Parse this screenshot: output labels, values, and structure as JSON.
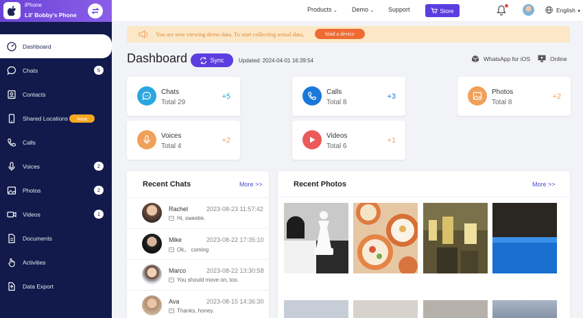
{
  "device": {
    "type": "iPhone",
    "name": "Lil' Bobby's Phone"
  },
  "sidebar": {
    "items": [
      {
        "label": "Dashboard",
        "icon": "dashboard-icon",
        "active": true
      },
      {
        "label": "Chats",
        "icon": "chat-icon",
        "badge": "5"
      },
      {
        "label": "Contacts",
        "icon": "contacts-icon"
      },
      {
        "label": "Shared Locations",
        "icon": "phone-location-icon",
        "new": "New"
      },
      {
        "label": "Calls",
        "icon": "phone-icon"
      },
      {
        "label": "Voices",
        "icon": "microphone-icon",
        "badge": "2"
      },
      {
        "label": "Photos",
        "icon": "image-icon",
        "badge": "2"
      },
      {
        "label": "Videos",
        "icon": "video-icon",
        "badge": "1"
      },
      {
        "label": "Documents",
        "icon": "document-icon"
      },
      {
        "label": "Activities",
        "icon": "hand-pointer-icon"
      },
      {
        "label": "Data Export",
        "icon": "export-icon"
      }
    ]
  },
  "topbar": {
    "products": "Products",
    "demo": "Demo",
    "support": "Support",
    "store": "Store",
    "language": "English"
  },
  "notice": {
    "text": "You are now viewing demo data. To start collecting actual data,",
    "button": "bind a device"
  },
  "header": {
    "title": "Dashboard",
    "sync": "Sync",
    "updated": "Updated: 2024-04-01 16:39:54",
    "whatsapp": "WhatsApp for iOS",
    "status": "Online"
  },
  "stats": [
    {
      "name": "Chats",
      "total": "Total   29",
      "inc": "+5",
      "color": "#2aa6e0"
    },
    {
      "name": "Calls",
      "total": "Total   8",
      "inc": "+3",
      "color": "#1a78d8"
    },
    {
      "name": "Photos",
      "total": "Total   8",
      "inc": "+2",
      "color": "#f0a05a"
    },
    {
      "name": "Voices",
      "total": "Total   4",
      "inc": "+2",
      "color": "#f0a05a"
    },
    {
      "name": "Videos",
      "total": "Total   6",
      "inc": "+1",
      "color": "#ea5a5a"
    }
  ],
  "recent_chats": {
    "title": "Recent Chats",
    "more": "More >>",
    "rows": [
      {
        "name": "Rachel",
        "time": "2023-08-23 11:57:42",
        "msg": "Hi, sweetie."
      },
      {
        "name": "Mike",
        "time": "2023-08-22 17:35:10",
        "msg": "Ok， coming"
      },
      {
        "name": "Marco",
        "time": "2023-08-22 13:30:58",
        "msg": "You should move on, too."
      },
      {
        "name": "Ava",
        "time": "2023-08-15 14:36:30",
        "msg": "Thanks, honey."
      }
    ]
  },
  "recent_photos": {
    "title": "Recent Photos",
    "more": "More >>"
  }
}
